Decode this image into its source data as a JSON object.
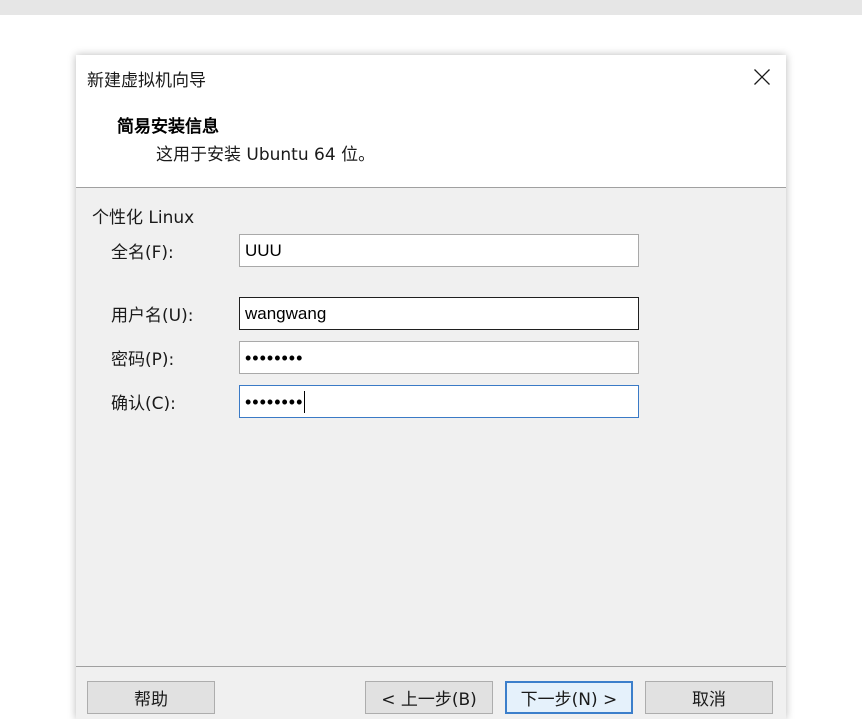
{
  "window": {
    "title": "新建虚拟机向导"
  },
  "header": {
    "title": "简易安装信息",
    "subtitle": "这用于安装 Ubuntu 64 位。"
  },
  "form": {
    "group_title": "个性化 Linux",
    "fullname": {
      "label": "全名(F):",
      "value": "UUU"
    },
    "username": {
      "label": "用户名(U):",
      "value": "wangwang"
    },
    "password": {
      "label": "密码(P):",
      "value": "••••••••"
    },
    "confirm": {
      "label": "确认(C):",
      "value": "••••••••"
    }
  },
  "buttons": {
    "help": "帮助",
    "back": "< 上一步(B)",
    "next": "下一步(N) >",
    "cancel": "取消"
  },
  "colors": {
    "focus_border": "#3a7ac6",
    "dialog_bg": "#f0f0f0"
  },
  "icons": {
    "close": "close-icon"
  }
}
